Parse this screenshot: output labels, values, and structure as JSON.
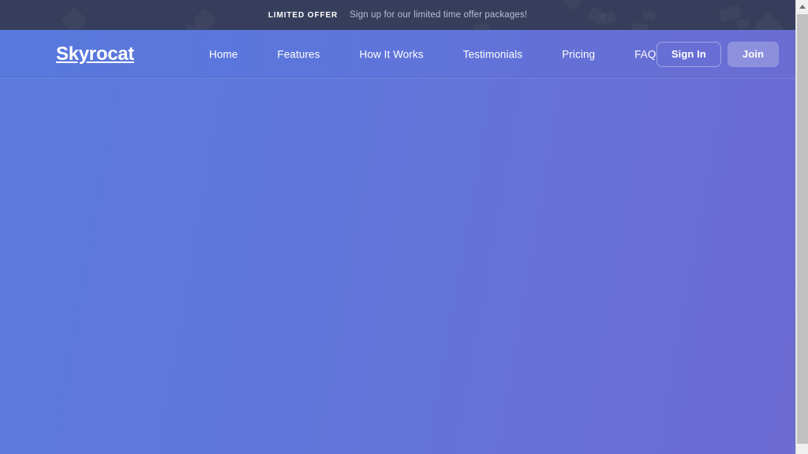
{
  "announcement": {
    "badge": "LIMITED OFFER",
    "message": "Sign up for our limited time offer packages!"
  },
  "navbar": {
    "logo": "Skyrocat",
    "links": [
      {
        "label": "Home"
      },
      {
        "label": "Features"
      },
      {
        "label": "How It Works"
      },
      {
        "label": "Testimonials"
      },
      {
        "label": "Pricing"
      },
      {
        "label": "FAQ"
      }
    ],
    "actions": {
      "sign_in": "Sign In",
      "join": "Join"
    }
  },
  "colors": {
    "announce_bg": "#363e5b",
    "brand_blue_left": "#5878dd",
    "brand_purple_right": "#6a6dd2",
    "badge_text": "#ffffff",
    "announce_text": "#b9bed2",
    "scrollbar_track": "#f0f0f0",
    "scrollbar_thumb": "#c1c1c1"
  }
}
